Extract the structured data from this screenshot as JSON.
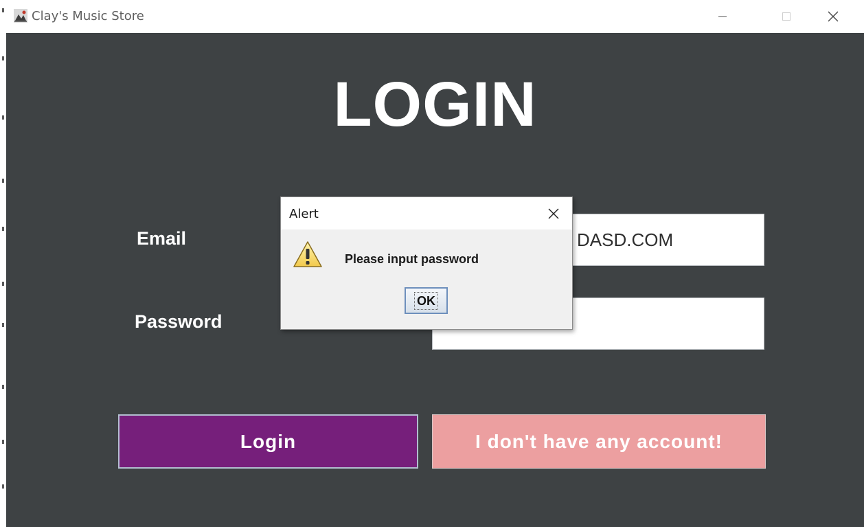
{
  "window": {
    "title": "Clay's Music Store"
  },
  "form": {
    "heading": "LOGIN",
    "email_label": "Email",
    "password_label": "Password",
    "email_value": "DASD.COM",
    "password_value": "",
    "login_label": "Login",
    "no_account_label": "I don't have any account!"
  },
  "dialog": {
    "title": "Alert",
    "message": "Please input password",
    "ok_label": "OK"
  },
  "colors": {
    "background": "#3e4244",
    "login_button": "#761f7b",
    "no_account_button": "#ec9fa0"
  },
  "icons": {
    "app": "app-icon",
    "minimize": "minimize-icon",
    "maximize": "maximize-icon",
    "close": "close-icon",
    "warning": "warning-icon"
  }
}
